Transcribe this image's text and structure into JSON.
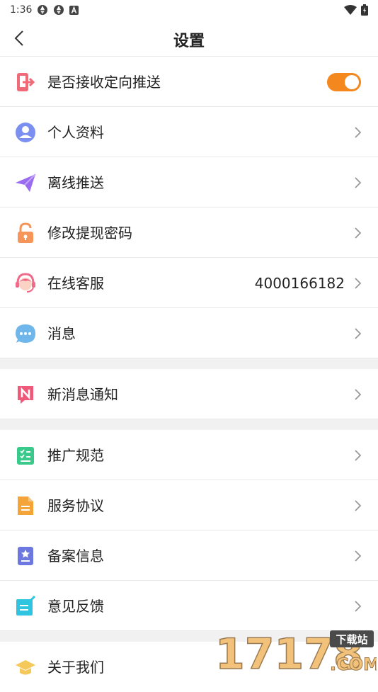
{
  "status_bar": {
    "time": "1:36"
  },
  "header": {
    "title": "设置"
  },
  "rows": [
    {
      "label": "是否接收定向推送",
      "toggle_on": true
    },
    {
      "label": "个人资料"
    },
    {
      "label": "离线推送"
    },
    {
      "label": "修改提现密码"
    },
    {
      "label": "在线客服",
      "value": "4000166182"
    },
    {
      "label": "消息"
    },
    {
      "label": "新消息通知"
    },
    {
      "label": "推广规范"
    },
    {
      "label": "服务协议"
    },
    {
      "label": "备案信息"
    },
    {
      "label": "意见反馈"
    },
    {
      "label": "关于我们"
    }
  ],
  "watermark": {
    "number": "17178",
    "suffix": ".COM",
    "tag": "下载站"
  },
  "colors": {
    "accent": "#f5871f",
    "divider_band": "#f1f1f1"
  }
}
